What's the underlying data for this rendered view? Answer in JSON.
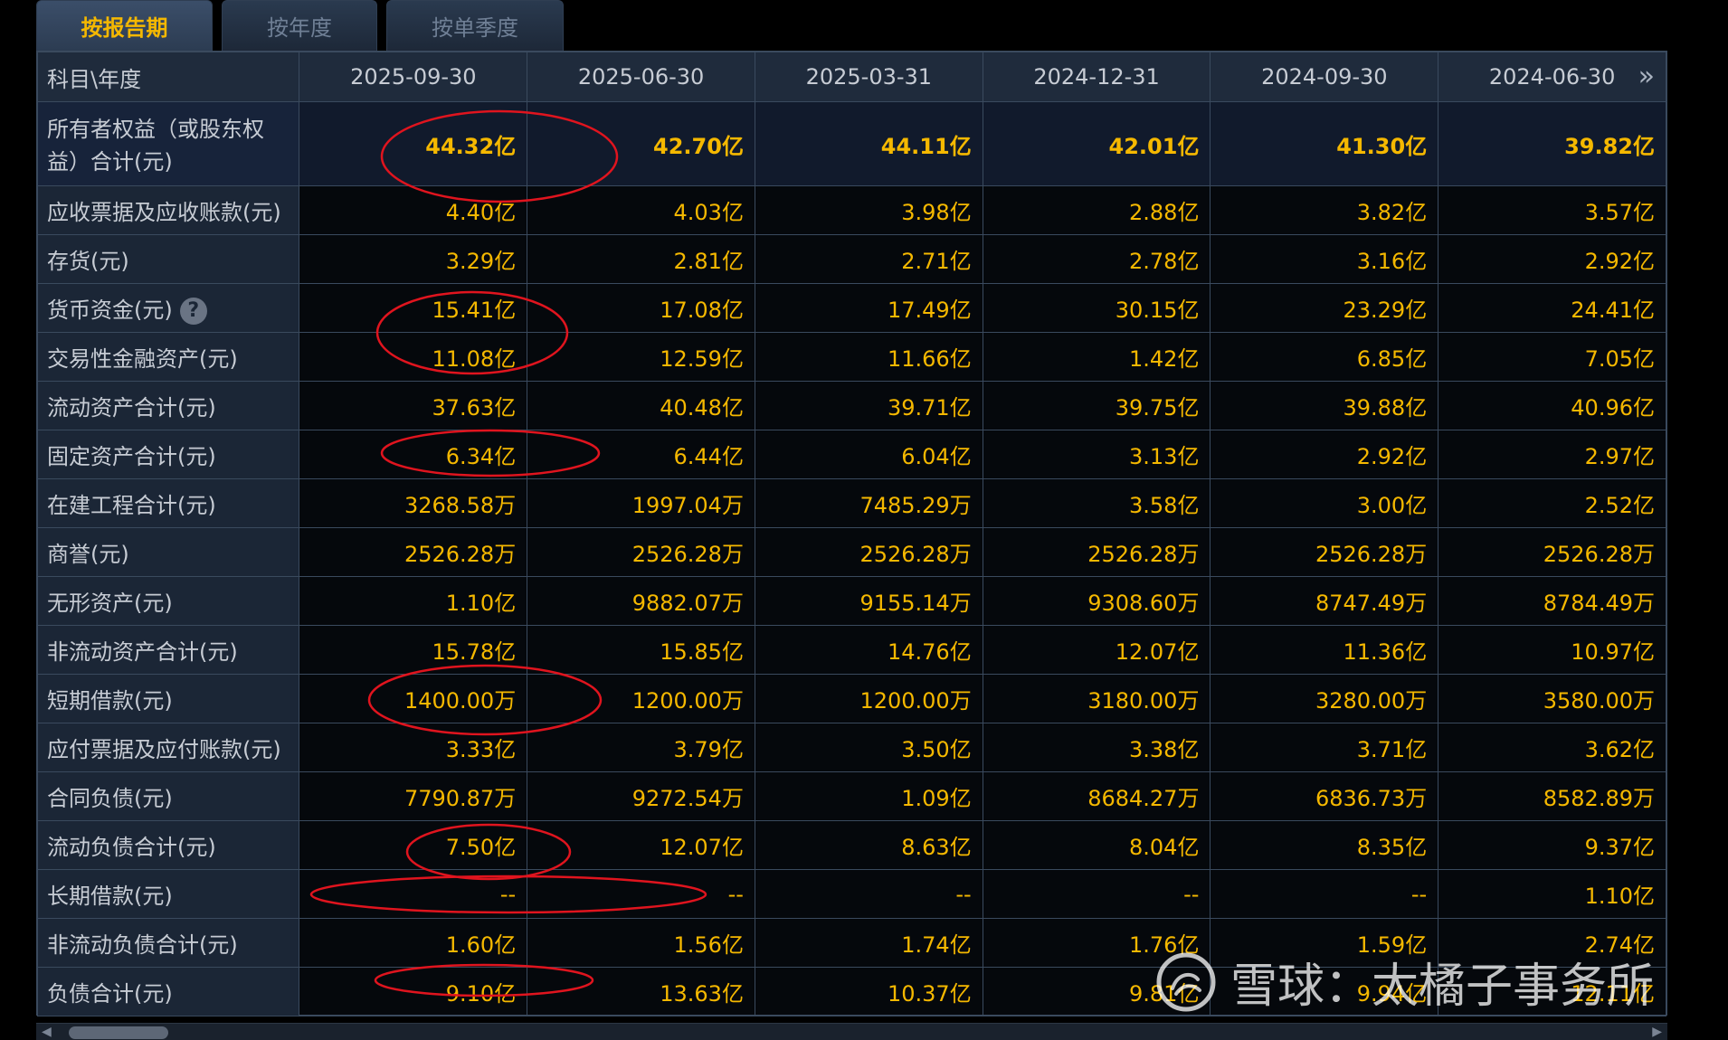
{
  "tabs": [
    {
      "label": "按报告期",
      "active": true
    },
    {
      "label": "按年度",
      "active": false
    },
    {
      "label": "按单季度",
      "active": false
    }
  ],
  "table": {
    "corner_header": "科目\\年度",
    "more_icon": "»",
    "periods": [
      "2025-09-30",
      "2025-06-30",
      "2025-03-31",
      "2024-12-31",
      "2024-09-30",
      "2024-06-30"
    ],
    "rows": [
      {
        "label": "所有者权益（或股东权益）合计(元)",
        "values": [
          "44.32亿",
          "42.70亿",
          "44.11亿",
          "42.01亿",
          "41.30亿",
          "39.82亿"
        ]
      },
      {
        "label": "应收票据及应收账款(元)",
        "values": [
          "4.40亿",
          "4.03亿",
          "3.98亿",
          "2.88亿",
          "3.82亿",
          "3.57亿"
        ]
      },
      {
        "label": "存货(元)",
        "values": [
          "3.29亿",
          "2.81亿",
          "2.71亿",
          "2.78亿",
          "3.16亿",
          "2.92亿"
        ]
      },
      {
        "label": "货币资金(元)",
        "help": "?",
        "values": [
          "15.41亿",
          "17.08亿",
          "17.49亿",
          "30.15亿",
          "23.29亿",
          "24.41亿"
        ]
      },
      {
        "label": "交易性金融资产(元)",
        "values": [
          "11.08亿",
          "12.59亿",
          "11.66亿",
          "1.42亿",
          "6.85亿",
          "7.05亿"
        ]
      },
      {
        "label": "流动资产合计(元)",
        "values": [
          "37.63亿",
          "40.48亿",
          "39.71亿",
          "39.75亿",
          "39.88亿",
          "40.96亿"
        ]
      },
      {
        "label": "固定资产合计(元)",
        "values": [
          "6.34亿",
          "6.44亿",
          "6.04亿",
          "3.13亿",
          "2.92亿",
          "2.97亿"
        ]
      },
      {
        "label": "在建工程合计(元)",
        "values": [
          "3268.58万",
          "1997.04万",
          "7485.29万",
          "3.58亿",
          "3.00亿",
          "2.52亿"
        ]
      },
      {
        "label": "商誉(元)",
        "values": [
          "2526.28万",
          "2526.28万",
          "2526.28万",
          "2526.28万",
          "2526.28万",
          "2526.28万"
        ]
      },
      {
        "label": "无形资产(元)",
        "values": [
          "1.10亿",
          "9882.07万",
          "9155.14万",
          "9308.60万",
          "8747.49万",
          "8784.49万"
        ]
      },
      {
        "label": "非流动资产合计(元)",
        "values": [
          "15.78亿",
          "15.85亿",
          "14.76亿",
          "12.07亿",
          "11.36亿",
          "10.97亿"
        ]
      },
      {
        "label": "短期借款(元)",
        "values": [
          "1400.00万",
          "1200.00万",
          "1200.00万",
          "3180.00万",
          "3280.00万",
          "3580.00万"
        ]
      },
      {
        "label": "应付票据及应付账款(元)",
        "values": [
          "3.33亿",
          "3.79亿",
          "3.50亿",
          "3.38亿",
          "3.71亿",
          "3.62亿"
        ]
      },
      {
        "label": "合同负债(元)",
        "values": [
          "7790.87万",
          "9272.54万",
          "1.09亿",
          "8684.27万",
          "6836.73万",
          "8582.89万"
        ]
      },
      {
        "label": "流动负债合计(元)",
        "values": [
          "7.50亿",
          "12.07亿",
          "8.63亿",
          "8.04亿",
          "8.35亿",
          "9.37亿"
        ]
      },
      {
        "label": "长期借款(元)",
        "values": [
          "--",
          "--",
          "--",
          "--",
          "--",
          "1.10亿"
        ]
      },
      {
        "label": "非流动负债合计(元)",
        "values": [
          "1.60亿",
          "1.56亿",
          "1.74亿",
          "1.76亿",
          "1.59亿",
          "2.74亿"
        ]
      },
      {
        "label": "负债合计(元)",
        "values": [
          "9.10亿",
          "13.63亿",
          "10.37亿",
          "9.81亿",
          "9.94亿",
          "12.11亿"
        ]
      }
    ]
  },
  "watermark": {
    "text": "雪球：太橘子事务所"
  },
  "colors": {
    "value": "#f5b800",
    "annotation": "#e0141e",
    "header_bg": "#1f2b3c",
    "label_bg": "#1b2636"
  }
}
